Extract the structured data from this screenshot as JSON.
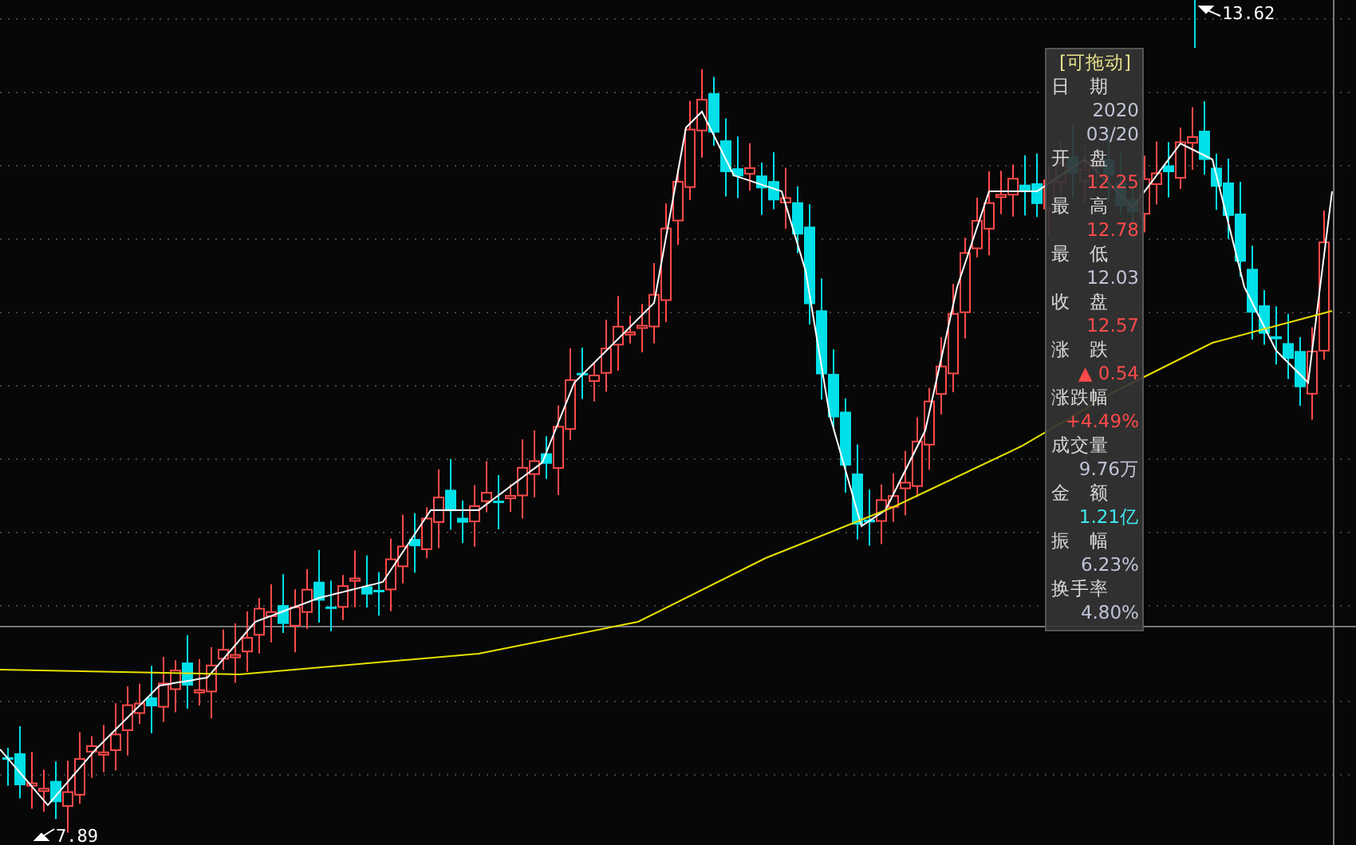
{
  "chart": {
    "high_label": "13.62",
    "low_label": "7.89"
  },
  "tooltip": {
    "title": "[可拖动]",
    "fields": [
      {
        "label": "日　期",
        "values": [
          {
            "text": "2020",
            "color": "#c0c4d8"
          },
          {
            "text": "03/20",
            "color": "#c0c4d8"
          }
        ]
      },
      {
        "label": "开　盘",
        "values": [
          {
            "text": "12.25",
            "color": "#ff4a4a"
          }
        ]
      },
      {
        "label": "最　高",
        "values": [
          {
            "text": "12.78",
            "color": "#ff4a4a"
          }
        ]
      },
      {
        "label": "最　低",
        "values": [
          {
            "text": "12.03",
            "color": "#c0c4d8"
          }
        ]
      },
      {
        "label": "收　盘",
        "values": [
          {
            "text": "12.57",
            "color": "#ff4a4a"
          }
        ]
      },
      {
        "label": "涨　跌",
        "values": [
          {
            "text": "▲ 0.54",
            "color": "#ff4a4a"
          }
        ]
      },
      {
        "label": "涨跌幅",
        "values": [
          {
            "text": "+4.49%",
            "color": "#ff4a4a"
          }
        ]
      },
      {
        "label": "成交量",
        "values": [
          {
            "text": "9.76万",
            "color": "#c0c4d8"
          }
        ]
      },
      {
        "label": "金　额",
        "values": [
          {
            "text": "1.21亿",
            "color": "#3ee8ee"
          }
        ]
      },
      {
        "label": "振　幅",
        "values": [
          {
            "text": "6.23%",
            "color": "#c0c4d8"
          }
        ]
      },
      {
        "label": "换手率",
        "values": [
          {
            "text": "4.80%",
            "color": "#c0c4d8"
          }
        ]
      }
    ]
  }
}
